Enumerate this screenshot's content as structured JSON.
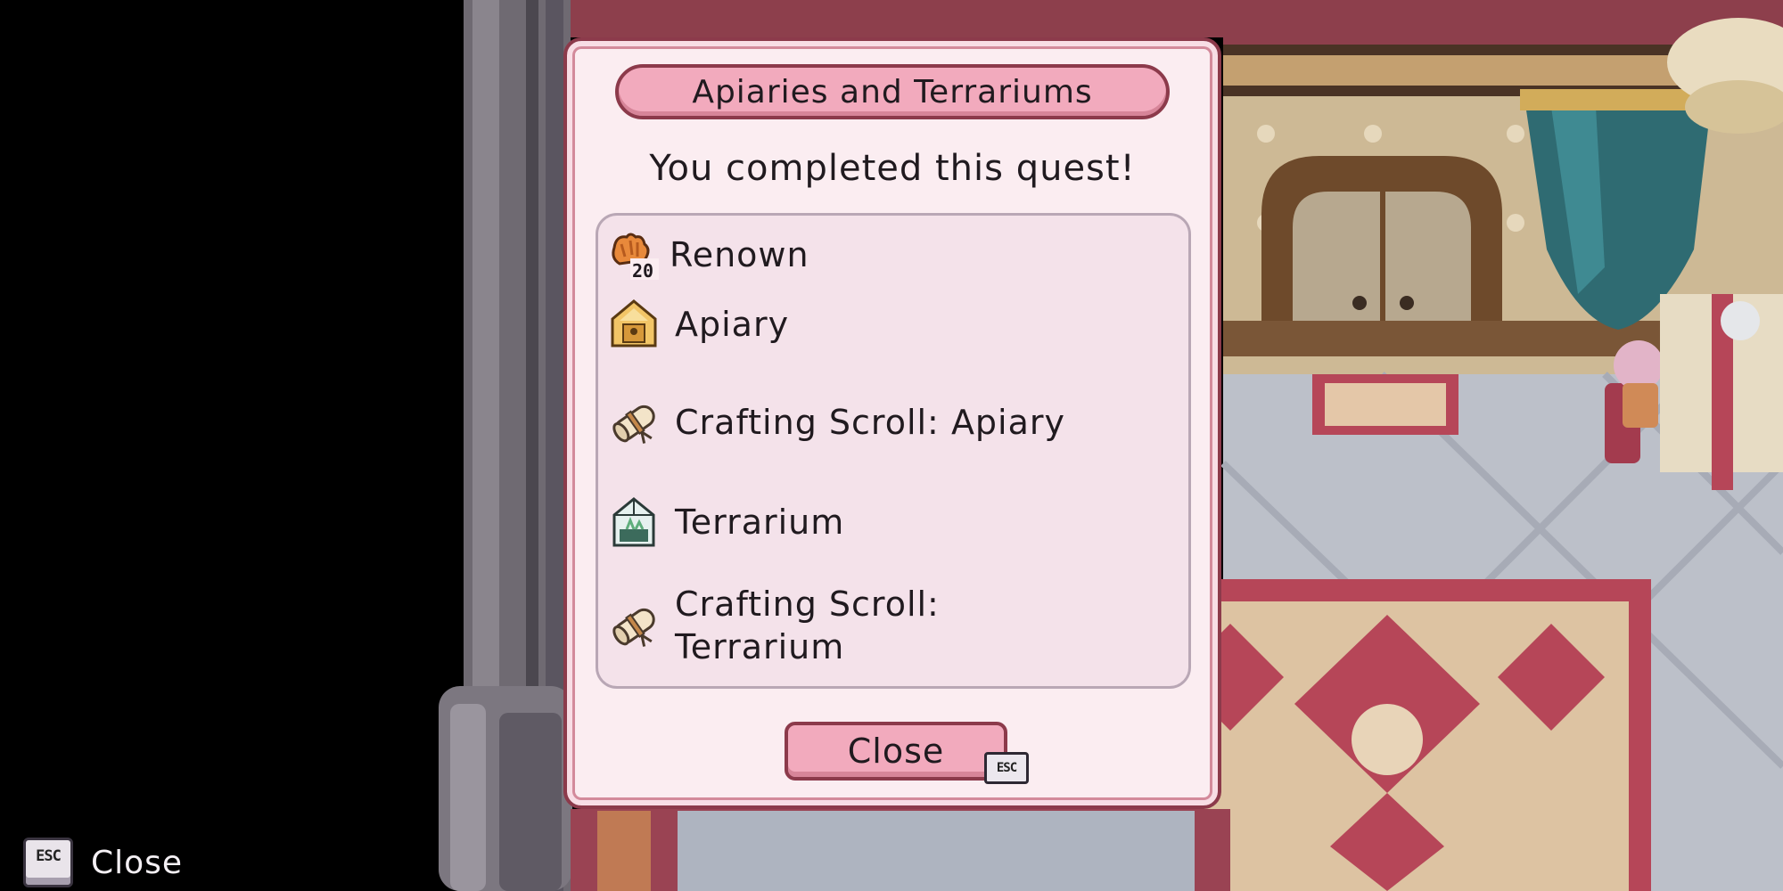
{
  "dialog": {
    "title": "Apiaries and Terrariums",
    "subtitle": "You completed this quest!",
    "rewards": [
      {
        "label": "Renown",
        "icon": "renown-icon",
        "badge": "20"
      },
      {
        "label": "Apiary",
        "icon": "apiary-icon"
      },
      {
        "label": "Crafting Scroll: Apiary",
        "icon": "crafting-scroll-icon"
      },
      {
        "label": "Terrarium",
        "icon": "terrarium-icon"
      },
      {
        "label": "Crafting Scroll:\nTerrarium",
        "icon": "crafting-scroll-icon"
      }
    ],
    "close_label": "Close",
    "close_key": "ESC"
  },
  "hint": {
    "key": "ESC",
    "label": "Close"
  }
}
